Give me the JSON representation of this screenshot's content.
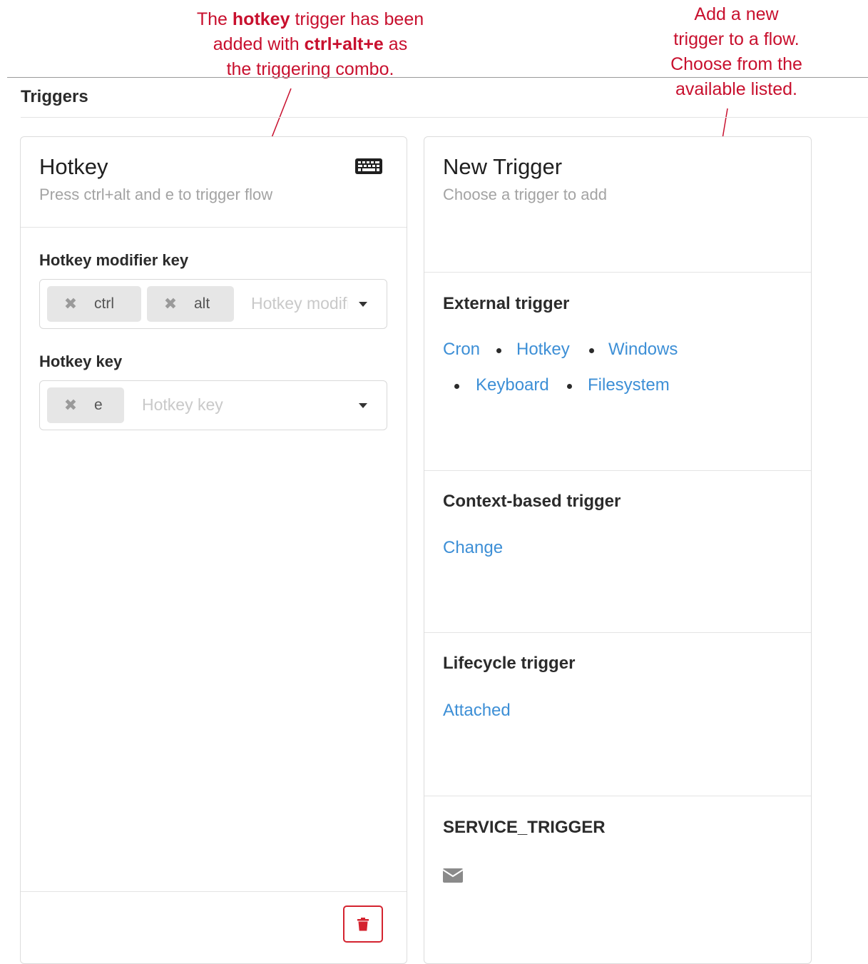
{
  "annotations": {
    "left": {
      "line1_pre": "The ",
      "line1_bold": "hotkey",
      "line1_post": " trigger has been",
      "line2_pre": "added with ",
      "line2_bold": "ctrl+alt+e",
      "line2_post": " as",
      "line3": "the triggering combo."
    },
    "right": {
      "line1": "Add a new",
      "line2": "trigger to a flow.",
      "line3": "Choose from the",
      "line4": "available listed."
    },
    "color": "#c8102e"
  },
  "section": {
    "title": "Triggers"
  },
  "hotkey_card": {
    "title": "Hotkey",
    "subtitle": "Press ctrl+alt and e to trigger flow",
    "icon": "keyboard-icon",
    "modifier_field": {
      "label": "Hotkey modifier key",
      "tags": [
        "ctrl",
        "alt"
      ],
      "placeholder": "Hotkey modifier key"
    },
    "key_field": {
      "label": "Hotkey key",
      "tags": [
        "e"
      ],
      "placeholder": "Hotkey key"
    },
    "delete_icon": "trash-icon",
    "delete_color": "#d4232f"
  },
  "new_trigger_card": {
    "title": "New Trigger",
    "subtitle": "Choose a trigger to add",
    "groups": {
      "external": {
        "title": "External trigger",
        "links": [
          "Cron",
          "Hotkey",
          "Windows",
          "Keyboard",
          "Filesystem"
        ]
      },
      "context": {
        "title": "Context-based trigger",
        "links": [
          "Change"
        ]
      },
      "lifecycle": {
        "title": "Lifecycle trigger",
        "links": [
          "Attached"
        ]
      },
      "service": {
        "title": "SERVICE_TRIGGER",
        "icon": "envelope-icon"
      }
    },
    "link_color": "#3d8fd6"
  }
}
